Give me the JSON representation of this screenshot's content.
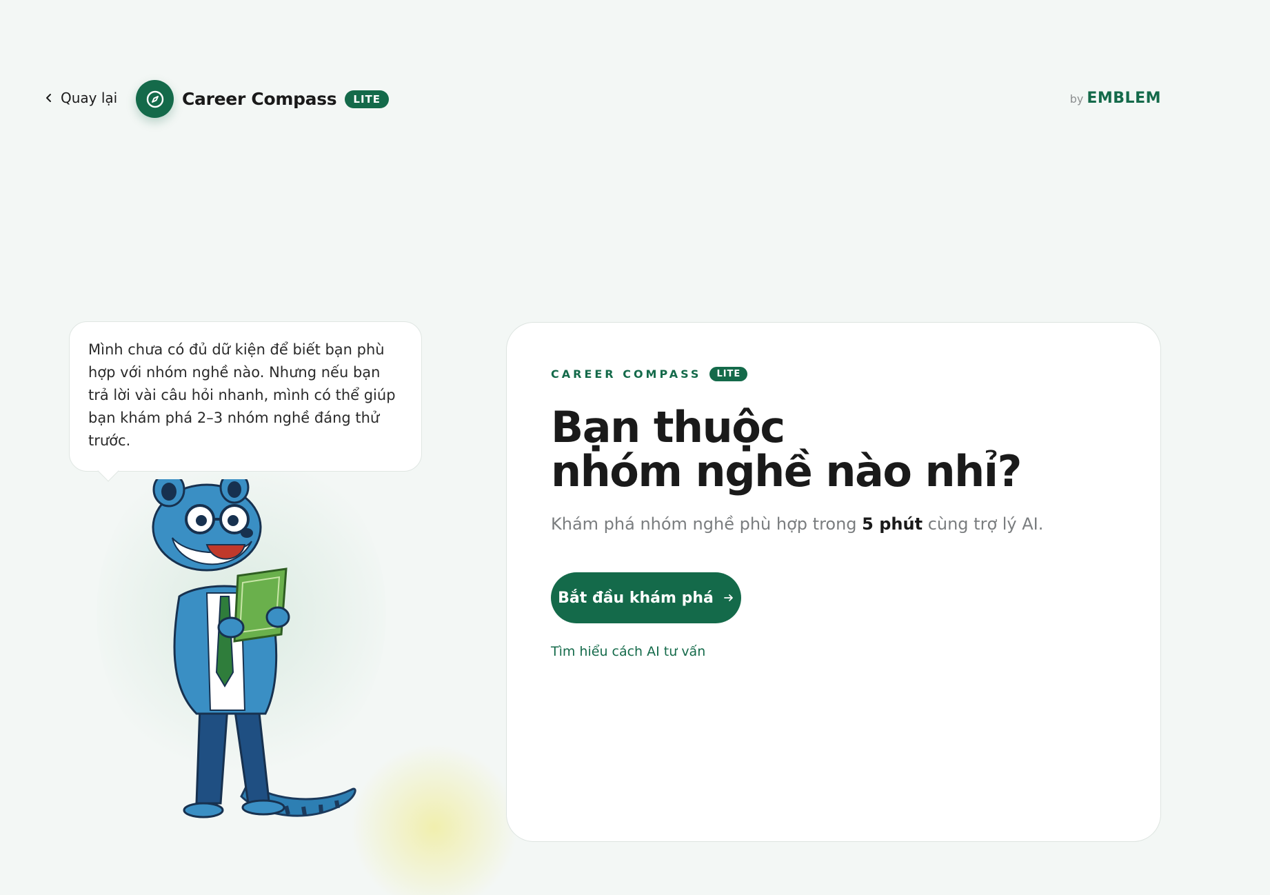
{
  "header": {
    "back_label": "Quay lại",
    "brand_name": "Career Compass",
    "brand_badge": "LITE",
    "by_label": "by",
    "company": "EMBLEM"
  },
  "mascot": {
    "speech": "Mình chưa có đủ dữ kiện để biết bạn phù hợp với nhóm nghề nào. Nhưng nếu bạn trả lời vài câu hỏi nhanh, mình có thể giúp bạn khám phá 2–3 nhóm nghề đáng thử trước."
  },
  "card": {
    "eyebrow": "CAREER COMPASS",
    "eyebrow_badge": "LITE",
    "headline_line1": "Bạn thuộc",
    "headline_line2": "nhóm nghề nào nhỉ?",
    "subline_before": "Khám phá nhóm nghề phù hợp trong ",
    "subline_bold": "5 phút",
    "subline_after": " cùng trợ lý AI.",
    "cta_label": "Bắt đầu khám phá",
    "learn_link": "Tìm hiểu cách AI tư vấn"
  },
  "colors": {
    "brand_green": "#146a4a",
    "background": "#f3f7f5",
    "mascot_blue": "#3a8fc4"
  },
  "icons": [
    "chevron-left-icon",
    "compass-icon",
    "arrow-right-icon"
  ]
}
